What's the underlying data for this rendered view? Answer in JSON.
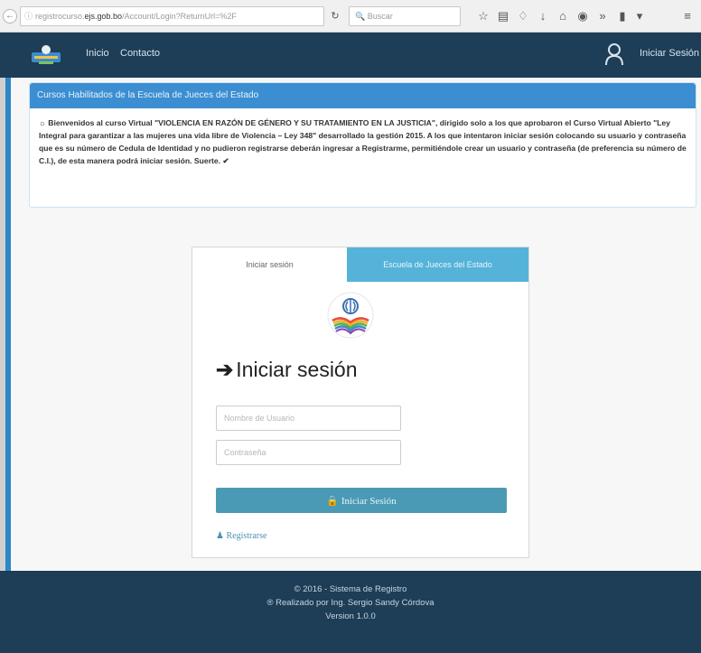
{
  "browser": {
    "url_prefix": "registrocurso.",
    "url_domain": "ejs.gob.bo",
    "url_path": "/Account/Login?ReturnUrl=%2F",
    "search_placeholder": "Buscar"
  },
  "navbar": {
    "links": [
      "Inicio",
      "Contacto"
    ],
    "login_label": "Iniciar Sesión"
  },
  "notice": {
    "heading": "Cursos Habilitados de la Escuela de Jueces del Estado",
    "body": "Bienvenidos al curso Virtual \"VIOLENCIA EN RAZÓN DE GÉNERO Y SU TRATAMIENTO EN LA JUSTICIA\", dirigido solo a los que aprobaron el Curso Virtual Abierto \"Ley Integral para garantizar a las mujeres una vida libre de Violencia – Ley 348\" desarrollado la gestión 2015. A los que intentaron iniciar sesión colocando su usuario y contraseña que es su número de Cedula de Identidad y no pudieron registrarse deberán ingresar a Registrarme, permitiéndole crear un usuario y contraseña (de preferencia su número de C.I.), de esta manera podrá iniciar sesión. Suerte."
  },
  "login": {
    "tabs": [
      "Iniciar sesión",
      "Escuela de Jueces del Estado"
    ],
    "title": "Iniciar sesión",
    "username_placeholder": "Nombre de Usuario",
    "password_placeholder": "Contraseña",
    "submit_label": "Iniciar Sesión",
    "register_label": "Registrarse"
  },
  "footer": {
    "line1": "© 2016 - Sistema de Registro",
    "line2": "® Realizado por Ing. Sergio Sandy Córdova",
    "line3": "Version 1.0.0"
  },
  "colors": {
    "navbar": "#1e3d56",
    "panel_heading": "#3a8ed1",
    "tab_inactive": "#55b3d9",
    "button": "#4a9ab6"
  }
}
